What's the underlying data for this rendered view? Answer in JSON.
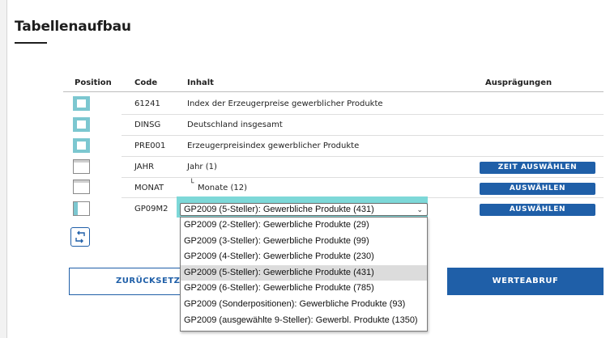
{
  "section": {
    "title": "Tabellenaufbau"
  },
  "columns": {
    "position": "Position",
    "code": "Code",
    "inhalt": "Inhalt",
    "auspraegungen": "Ausprägungen"
  },
  "rows": [
    {
      "code": "61241",
      "inhalt": "Index der Erzeugerpreise gewerblicher Produkte",
      "button": ""
    },
    {
      "code": "DINSG",
      "inhalt": "Deutschland insgesamt",
      "button": ""
    },
    {
      "code": "PRE001",
      "inhalt": "Erzeugerpreisindex gewerblicher Produkte",
      "button": ""
    },
    {
      "code": "JAHR",
      "inhalt": "Jahr (1)",
      "button": "ZEIT AUSWÄHLEN"
    },
    {
      "code": "MONAT",
      "inhalt": "Monate (12)",
      "prefix": "└",
      "button": "AUSWÄHLEN"
    },
    {
      "code": "GP09M2",
      "inhalt": "",
      "button": "AUSWÄHLEN"
    }
  ],
  "select": {
    "value": "GP2009 (5-Steller): Gewerbliche Produkte (431)",
    "options": [
      "GP2009 (2-Steller): Gewerbliche Produkte (29)",
      "GP2009 (3-Steller): Gewerbliche Produkte (99)",
      "GP2009 (4-Steller): Gewerbliche Produkte (230)",
      "GP2009 (5-Steller): Gewerbliche Produkte (431)",
      "GP2009 (6-Steller): Gewerbliche Produkte (785)",
      "GP2009 (Sonderpositionen): Gewerbliche Produkte (93)",
      "GP2009 (ausgewählte 9-Steller): Gewerbl. Produkte (1350)"
    ]
  },
  "actions": {
    "reset": "ZURÜCKSETZEN",
    "fetch": "WERTEABRUF"
  },
  "icons": {
    "swap": "swap-icon",
    "chevron": "chevron-down-icon"
  },
  "colors": {
    "accent": "#1f5fa8",
    "highlight": "#7cc7d0"
  }
}
